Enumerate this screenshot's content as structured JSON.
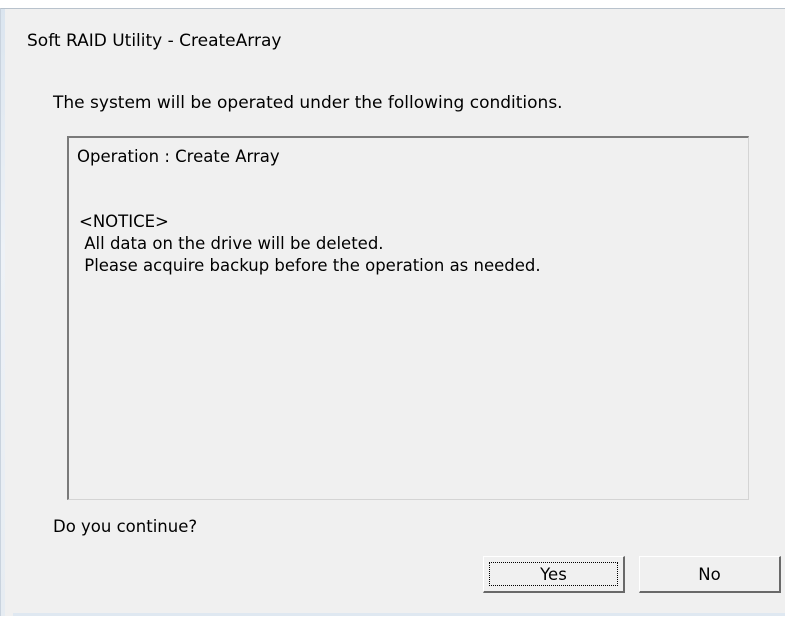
{
  "window": {
    "title": "Soft RAID Utility - CreateArray"
  },
  "dialog": {
    "intro": "The system will be operated under the following conditions.",
    "details": [
      "Operation : Create Array",
      "<NOTICE>",
      " All data on the drive will be deleted.",
      " Please acquire backup before the operation as needed."
    ],
    "question": "Do you continue?"
  },
  "buttons": {
    "yes": "Yes",
    "no": "No"
  }
}
